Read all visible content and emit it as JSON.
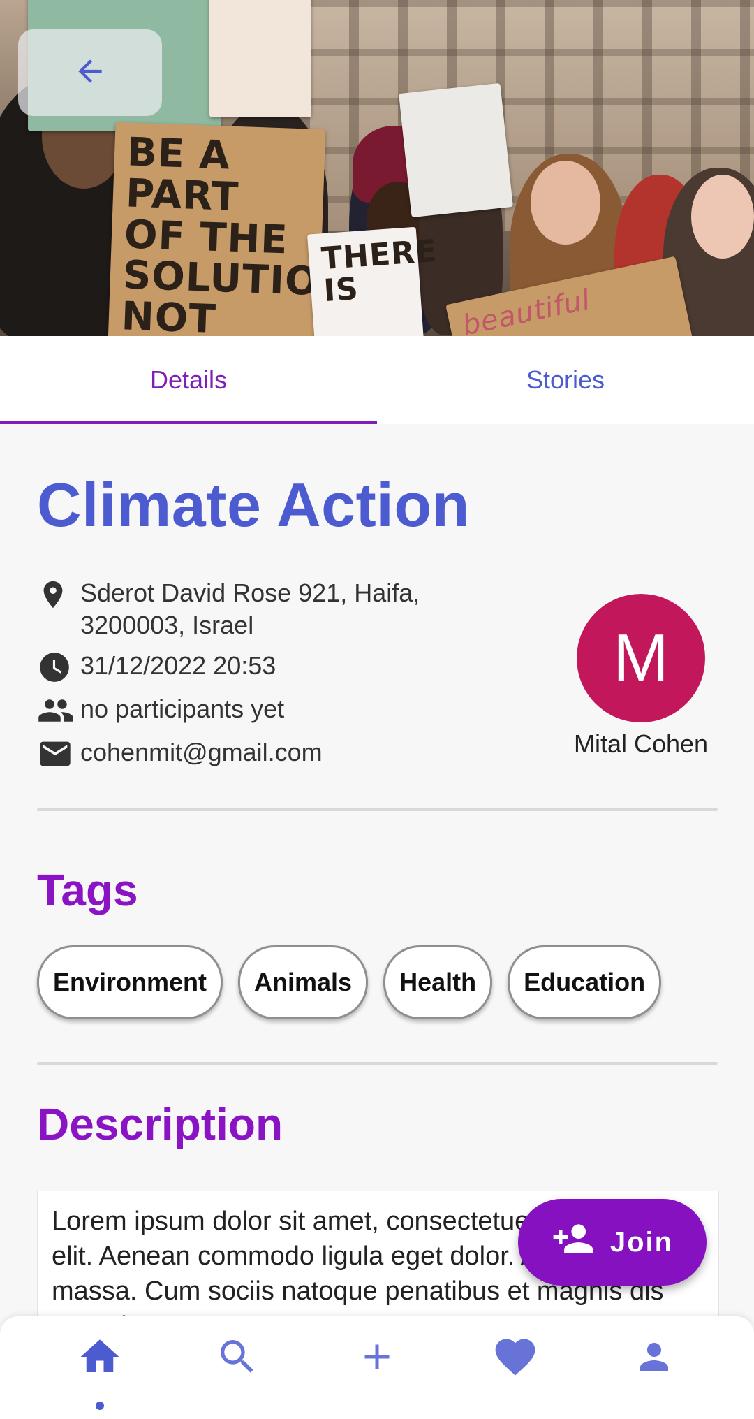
{
  "colors": {
    "primary": "#4c5bd0",
    "accent": "#8a14c4",
    "avatar_bg": "#c2185b",
    "join_bg": "#8511c0"
  },
  "header": {
    "back_icon": "arrow-back-icon",
    "image_signs": [
      "BE A PART OF THE SOLUTION, NOT PART OF",
      "THERE IS",
      "beautiful"
    ]
  },
  "tabs": [
    {
      "label": "Details",
      "active": true
    },
    {
      "label": "Stories",
      "active": false
    }
  ],
  "event": {
    "title": "Climate Action",
    "address_line1": "Sderot David Rose 921, Haifa,",
    "address_line2": "3200003, Israel",
    "datetime": "31/12/2022 20:53",
    "participants": "no participants yet",
    "email": "cohenmit@gmail.com"
  },
  "organizer": {
    "initial": "M",
    "name": "Mital Cohen"
  },
  "tags_section": {
    "title": "Tags",
    "tags": [
      "Environment",
      "Animals",
      "Health",
      "Education"
    ]
  },
  "description_section": {
    "title": "Description",
    "text": "Lorem ipsum dolor sit amet, consectetuer adipiscing elit. Aenean commodo ligula eget dolor. Aenean massa. Cum sociis natoque penatibus et magnis dis parturient"
  },
  "join_button": {
    "label": "Join",
    "icon": "person-add-icon"
  },
  "bottom_nav": [
    {
      "icon": "home-icon",
      "active": true
    },
    {
      "icon": "search-icon",
      "active": false
    },
    {
      "icon": "add-icon",
      "active": false
    },
    {
      "icon": "heart-icon",
      "active": false
    },
    {
      "icon": "person-icon",
      "active": false
    }
  ]
}
